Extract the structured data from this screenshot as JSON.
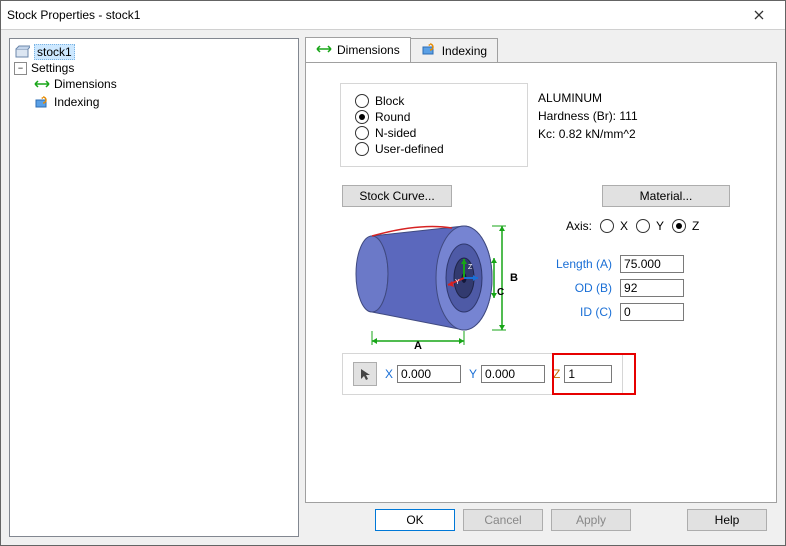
{
  "window": {
    "title": "Stock Properties - stock1"
  },
  "tree": {
    "root": {
      "label": "stock1"
    },
    "settings": {
      "label": "Settings"
    },
    "dimensions": {
      "label": "Dimensions"
    },
    "indexing": {
      "label": "Indexing"
    }
  },
  "tabs": {
    "dimensions": "Dimensions",
    "indexing": "Indexing",
    "active": "dimensions"
  },
  "shape": {
    "block": "Block",
    "round": "Round",
    "nsided": "N-sided",
    "userdef": "User-defined",
    "selected": "round"
  },
  "material": {
    "name": "ALUMINUM",
    "hardness_label": "Hardness (Br):",
    "hardness_value": "111",
    "kc_label": "Kc:",
    "kc_value": "0.82 kN/mm^2"
  },
  "buttons": {
    "stock_curve": "Stock Curve...",
    "material": "Material...",
    "ok": "OK",
    "cancel": "Cancel",
    "apply": "Apply",
    "help": "Help"
  },
  "axis": {
    "label": "Axis:",
    "x": "X",
    "y": "Y",
    "z": "Z",
    "selected": "z"
  },
  "dimensions": {
    "length_label": "Length (A)",
    "length_value": "75.000",
    "od_label": "OD (B)",
    "od_value": "92",
    "id_label": "ID (C)",
    "id_value": "0"
  },
  "diagram": {
    "label_A": "A",
    "label_B": "B",
    "label_C": "C"
  },
  "origin": {
    "x_label": "X",
    "x_value": "0.000",
    "y_label": "Y",
    "y_value": "0.000",
    "z_label": "Z",
    "z_value": "1"
  }
}
